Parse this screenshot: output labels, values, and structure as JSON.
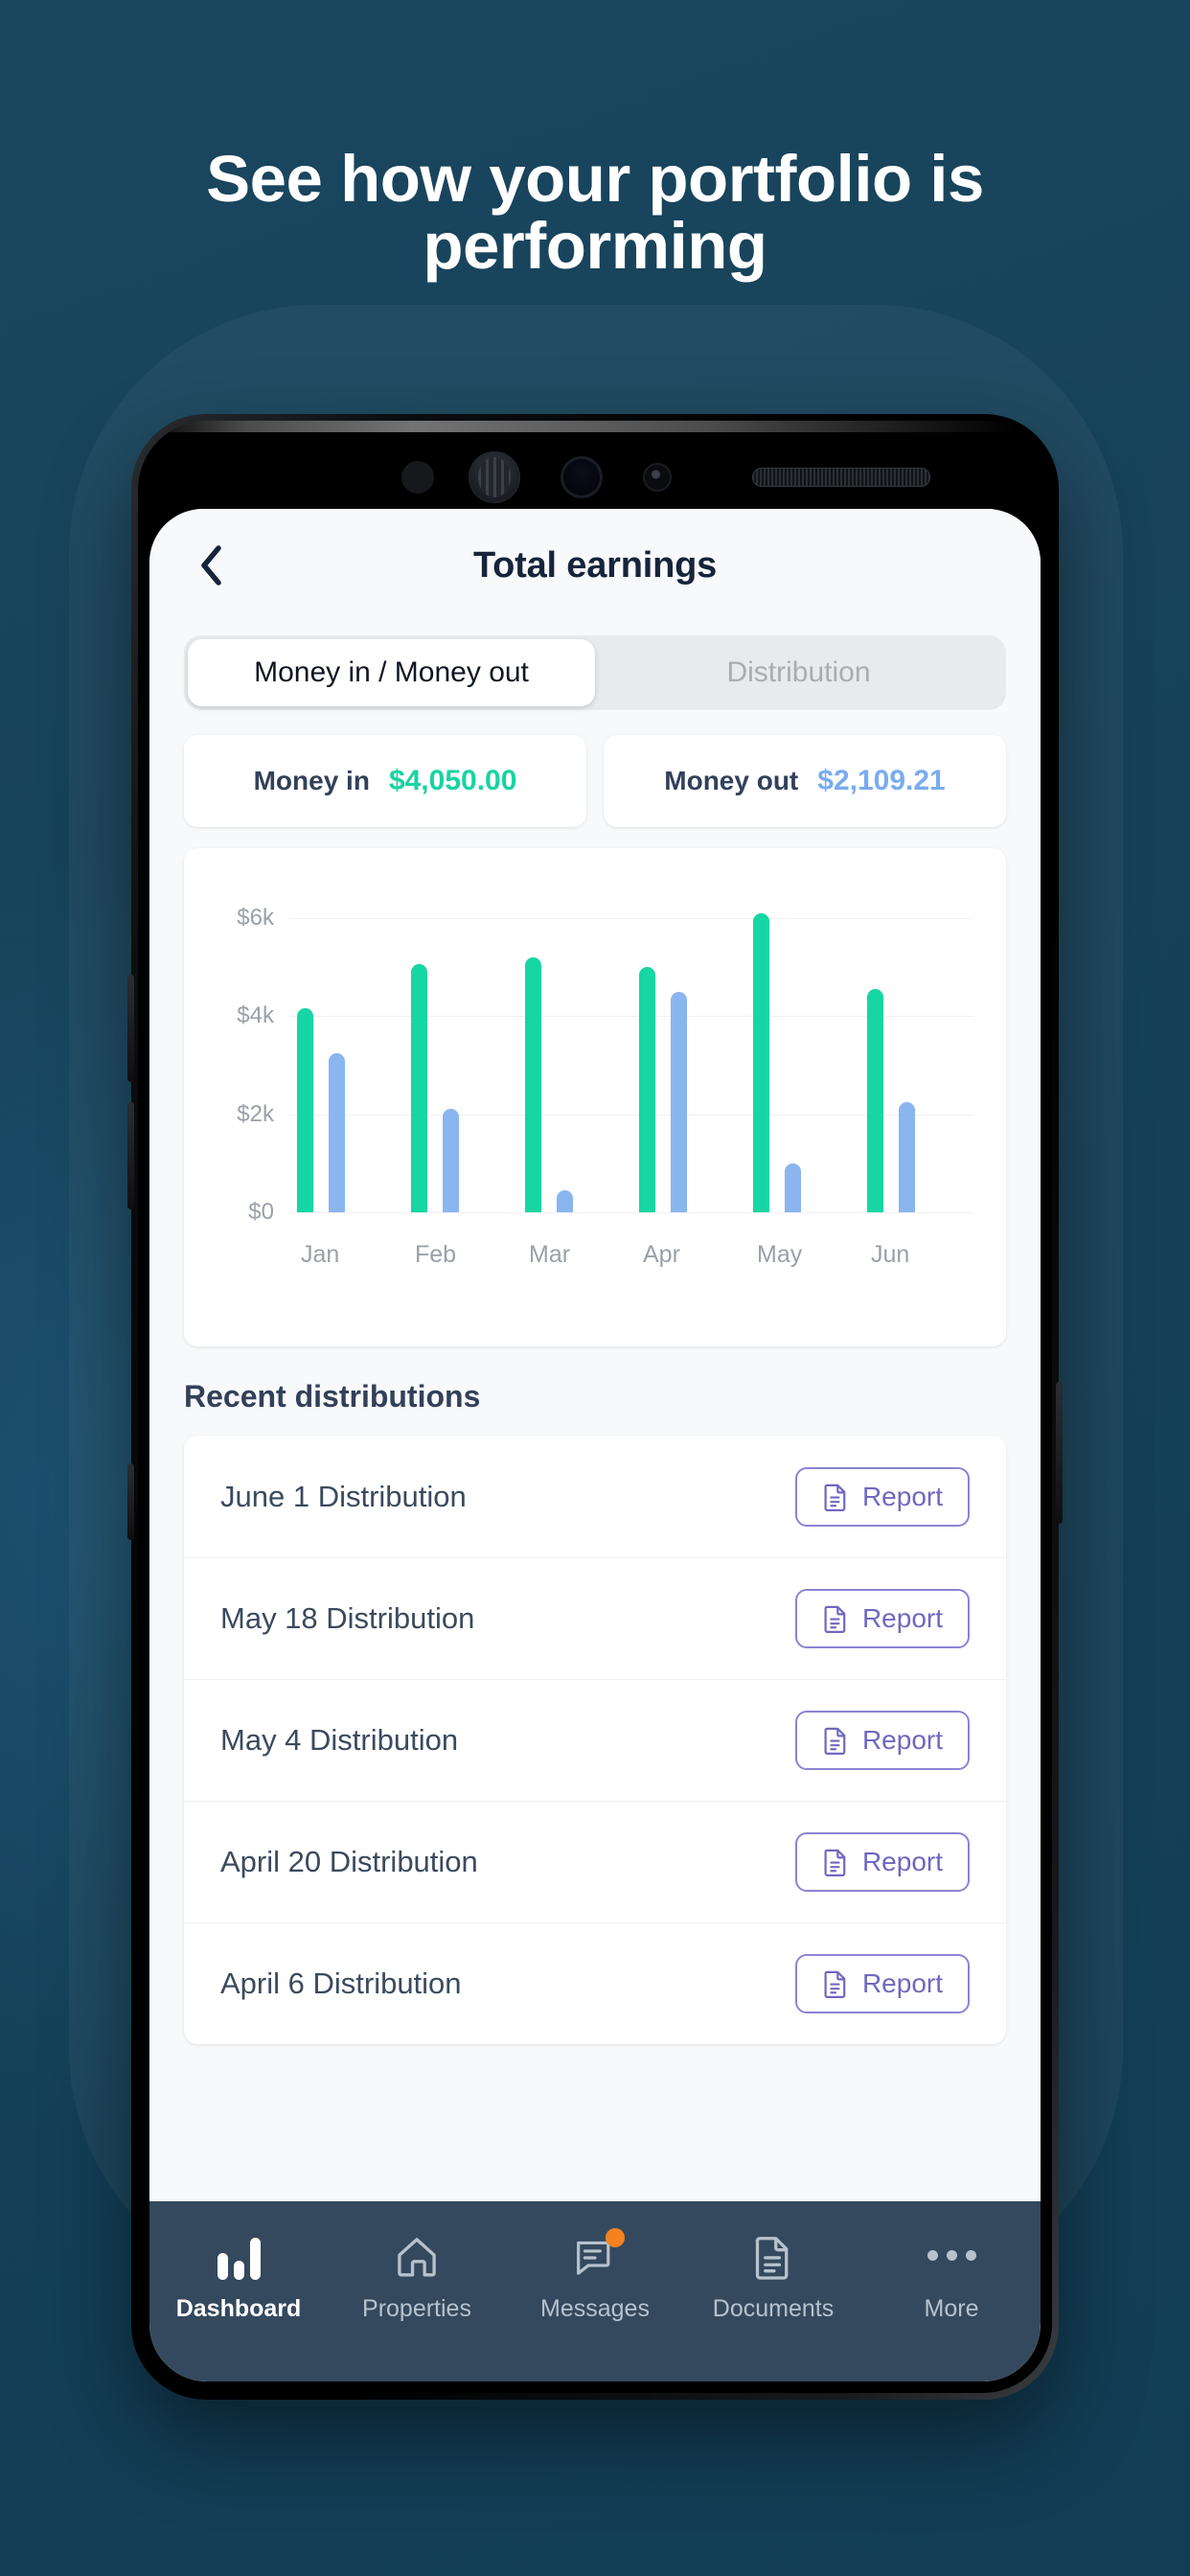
{
  "promo": {
    "headline_line1": "See how your portfolio is",
    "headline_line2": "performing",
    "background_color": "#16405a"
  },
  "app": {
    "header": {
      "back_icon": "chevron-left-icon",
      "title": "Total earnings"
    },
    "segmented": {
      "tabs": [
        {
          "label": "Money in / Money out",
          "active": true
        },
        {
          "label": "Distribution",
          "active": false
        }
      ]
    },
    "stats": [
      {
        "label": "Money in",
        "value": "$4,050.00",
        "color": "#19d3a2"
      },
      {
        "label": "Money out",
        "value": "$2,109.21",
        "color": "#79acee"
      }
    ],
    "distributions": {
      "section_title": "Recent distributions",
      "report_label": "Report",
      "report_icon": "document-icon",
      "rows": [
        {
          "name": "June 1 Distribution"
        },
        {
          "name": "May 18 Distribution"
        },
        {
          "name": "May 4 Distribution"
        },
        {
          "name": "April 20 Distribution"
        },
        {
          "name": "April 6 Distribution"
        }
      ]
    },
    "bottom_nav": {
      "items": [
        {
          "label": "Dashboard",
          "icon": "bar-chart-icon",
          "active": true,
          "badge": false
        },
        {
          "label": "Properties",
          "icon": "home-icon",
          "active": false,
          "badge": false
        },
        {
          "label": "Messages",
          "icon": "chat-icon",
          "active": false,
          "badge": true
        },
        {
          "label": "Documents",
          "icon": "document-icon",
          "active": false,
          "badge": false
        },
        {
          "label": "More",
          "icon": "ellipsis-icon",
          "active": false,
          "badge": false
        }
      ],
      "badge_color": "#f5821f",
      "background_color": "#34495e"
    }
  },
  "chart_data": {
    "type": "bar",
    "title": "",
    "xlabel": "",
    "ylabel": "",
    "categories": [
      "Jan",
      "Feb",
      "Mar",
      "Apr",
      "May",
      "Jun"
    ],
    "series": [
      {
        "name": "Money in",
        "color": "#16d6a4",
        "values": [
          4150,
          5050,
          5200,
          5000,
          6100,
          4550
        ]
      },
      {
        "name": "Money out",
        "color": "#8ab6ef",
        "values": [
          3250,
          2100,
          450,
          4500,
          1000,
          2250
        ]
      }
    ],
    "ylim": [
      0,
      6600
    ],
    "yticks": [
      0,
      2000,
      4000,
      6000
    ],
    "ytick_labels": [
      "$0",
      "$2k",
      "$4k",
      "$6k"
    ],
    "grid": true,
    "legend": "none"
  },
  "phone_chrome": {
    "sensors": [
      "ir-sensor",
      "iris-scanner",
      "front-camera",
      "proximity-sensor",
      "earpiece-speaker"
    ]
  }
}
